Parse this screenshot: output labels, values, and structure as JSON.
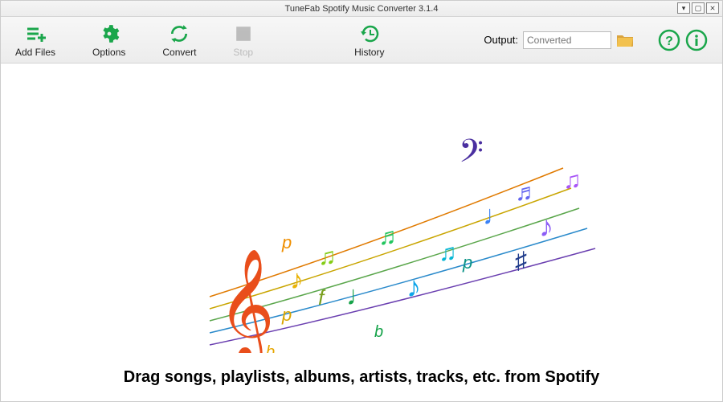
{
  "window": {
    "title": "TuneFab Spotify Music Converter 3.1.4"
  },
  "toolbar": {
    "add_files": "Add Files",
    "options": "Options",
    "convert": "Convert",
    "stop": "Stop",
    "history": "History"
  },
  "output": {
    "label": "Output:",
    "placeholder": "Converted"
  },
  "main": {
    "drop_hint": "Drag songs, playlists, albums, artists, tracks, etc. from Spotify"
  },
  "colors": {
    "accent": "#1aa64b"
  }
}
